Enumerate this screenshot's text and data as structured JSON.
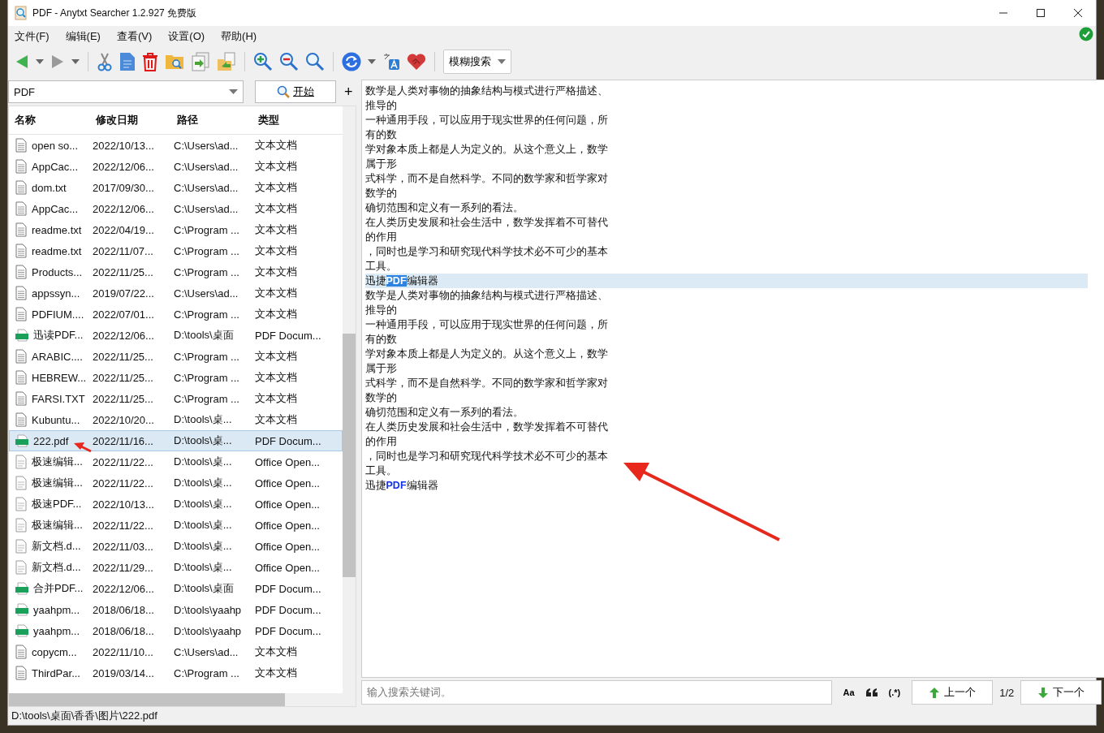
{
  "window": {
    "title": "PDF - Anytxt Searcher 1.2.927 免费版"
  },
  "menu": [
    "文件(F)",
    "编辑(E)",
    "查看(V)",
    "设置(O)",
    "帮助(H)"
  ],
  "toolbar": {
    "search_mode": "模糊搜索"
  },
  "search": {
    "value": "PDF",
    "start_button": "开始",
    "add_button": "+"
  },
  "table": {
    "columns": [
      "名称",
      "修改日期",
      "路径",
      "类型"
    ],
    "rows": [
      {
        "kind": "txt",
        "selected": false,
        "cells": [
          "open so...",
          "2022/10/13...",
          "C:\\Users\\ad...",
          "文本文档"
        ]
      },
      {
        "kind": "txt",
        "selected": false,
        "cells": [
          "AppCac...",
          "2022/12/06...",
          "C:\\Users\\ad...",
          "文本文档"
        ]
      },
      {
        "kind": "txt",
        "selected": false,
        "cells": [
          "dom.txt",
          "2017/09/30...",
          "C:\\Users\\ad...",
          "文本文档"
        ]
      },
      {
        "kind": "txt",
        "selected": false,
        "cells": [
          "AppCac...",
          "2022/12/06...",
          "C:\\Users\\ad...",
          "文本文档"
        ]
      },
      {
        "kind": "txt",
        "selected": false,
        "cells": [
          "readme.txt",
          "2022/04/19...",
          "C:\\Program ...",
          "文本文档"
        ]
      },
      {
        "kind": "txt",
        "selected": false,
        "cells": [
          "readme.txt",
          "2022/11/07...",
          "C:\\Program ...",
          "文本文档"
        ]
      },
      {
        "kind": "txt",
        "selected": false,
        "cells": [
          "Products...",
          "2022/11/25...",
          "C:\\Program ...",
          "文本文档"
        ]
      },
      {
        "kind": "txt",
        "selected": false,
        "cells": [
          "appssyn...",
          "2019/07/22...",
          "C:\\Users\\ad...",
          "文本文档"
        ]
      },
      {
        "kind": "txt",
        "selected": false,
        "cells": [
          "PDFIUM....",
          "2022/07/01...",
          "C:\\Program ...",
          "文本文档"
        ]
      },
      {
        "kind": "pdf",
        "selected": false,
        "cells": [
          "迅读PDF...",
          "2022/12/06...",
          "D:\\tools\\桌面",
          "PDF Docum..."
        ]
      },
      {
        "kind": "txt",
        "selected": false,
        "cells": [
          "ARABIC....",
          "2022/11/25...",
          "C:\\Program ...",
          "文本文档"
        ]
      },
      {
        "kind": "txt",
        "selected": false,
        "cells": [
          "HEBREW...",
          "2022/11/25...",
          "C:\\Program ...",
          "文本文档"
        ]
      },
      {
        "kind": "txt",
        "selected": false,
        "cells": [
          "FARSI.TXT",
          "2022/11/25...",
          "C:\\Program ...",
          "文本文档"
        ]
      },
      {
        "kind": "txt",
        "selected": false,
        "cells": [
          "Kubuntu...",
          "2022/10/20...",
          "D:\\tools\\桌...",
          "文本文档"
        ]
      },
      {
        "kind": "pdf",
        "selected": true,
        "cells": [
          "222.pdf",
          "2022/11/16...",
          "D:\\tools\\桌...",
          "PDF Docum..."
        ]
      },
      {
        "kind": "doc",
        "selected": false,
        "cells": [
          "极速编辑...",
          "2022/11/22...",
          "D:\\tools\\桌...",
          "Office Open..."
        ]
      },
      {
        "kind": "doc",
        "selected": false,
        "cells": [
          "极速编辑...",
          "2022/11/22...",
          "D:\\tools\\桌...",
          "Office Open..."
        ]
      },
      {
        "kind": "doc",
        "selected": false,
        "cells": [
          "极速PDF...",
          "2022/10/13...",
          "D:\\tools\\桌...",
          "Office Open..."
        ]
      },
      {
        "kind": "doc",
        "selected": false,
        "cells": [
          "极速编辑...",
          "2022/11/22...",
          "D:\\tools\\桌...",
          "Office Open..."
        ]
      },
      {
        "kind": "doc",
        "selected": false,
        "cells": [
          "新文档.d...",
          "2022/11/03...",
          "D:\\tools\\桌...",
          "Office Open..."
        ]
      },
      {
        "kind": "doc",
        "selected": false,
        "cells": [
          "新文档.d...",
          "2022/11/29...",
          "D:\\tools\\桌...",
          "Office Open..."
        ]
      },
      {
        "kind": "pdf",
        "selected": false,
        "cells": [
          "合并PDF...",
          "2022/12/06...",
          "D:\\tools\\桌面",
          "PDF Docum..."
        ]
      },
      {
        "kind": "pdf",
        "selected": false,
        "cells": [
          "yaahpm...",
          "2018/06/18...",
          "D:\\tools\\yaahp",
          "PDF Docum..."
        ]
      },
      {
        "kind": "pdf",
        "selected": false,
        "cells": [
          "yaahpm...",
          "2018/06/18...",
          "D:\\tools\\yaahp",
          "PDF Docum..."
        ]
      },
      {
        "kind": "txt",
        "selected": false,
        "cells": [
          "copycm...",
          "2022/11/10...",
          "C:\\Users\\ad...",
          "文本文档"
        ]
      },
      {
        "kind": "txt",
        "selected": false,
        "cells": [
          "ThirdPar...",
          "2019/03/14...",
          "C:\\Program ...",
          "文本文档"
        ]
      }
    ]
  },
  "preview": {
    "lines": [
      {
        "current": false,
        "parts": [
          {
            "text": "数学是人类对事物的抽象结构与模式进行严格描述、",
            "match": false
          }
        ]
      },
      {
        "current": false,
        "parts": [
          {
            "text": "推导的",
            "match": false
          }
        ]
      },
      {
        "current": false,
        "parts": [
          {
            "text": "一种通用手段，可以应用于现实世界的任何问题，所",
            "match": false
          }
        ]
      },
      {
        "current": false,
        "parts": [
          {
            "text": "有的数",
            "match": false
          }
        ]
      },
      {
        "current": false,
        "parts": [
          {
            "text": "学对象本质上都是人为定义的。从这个意义上，数学",
            "match": false
          }
        ]
      },
      {
        "current": false,
        "parts": [
          {
            "text": "属于形",
            "match": false
          }
        ]
      },
      {
        "current": false,
        "parts": [
          {
            "text": "式科学，而不是自然科学。不同的数学家和哲学家对",
            "match": false
          }
        ]
      },
      {
        "current": false,
        "parts": [
          {
            "text": "数学的",
            "match": false
          }
        ]
      },
      {
        "current": false,
        "parts": [
          {
            "text": "确切范围和定义有一系列的看法。",
            "match": false
          }
        ]
      },
      {
        "current": false,
        "parts": [
          {
            "text": "在人类历史发展和社会生活中，数学发挥着不可替代",
            "match": false
          }
        ]
      },
      {
        "current": false,
        "parts": [
          {
            "text": "的作用",
            "match": false
          }
        ]
      },
      {
        "current": false,
        "parts": [
          {
            "text": "，同时也是学习和研究现代科学技术必不可少的基本",
            "match": false
          }
        ]
      },
      {
        "current": false,
        "parts": [
          {
            "text": "工具。",
            "match": false
          }
        ]
      },
      {
        "current": true,
        "parts": [
          {
            "text": "迅捷",
            "match": false
          },
          {
            "text": "PDF",
            "match": true
          },
          {
            "text": "编辑器",
            "match": false
          }
        ]
      },
      {
        "current": false,
        "parts": [
          {
            "text": "数学是人类对事物的抽象结构与模式进行严格描述、",
            "match": false
          }
        ]
      },
      {
        "current": false,
        "parts": [
          {
            "text": "推导的",
            "match": false
          }
        ]
      },
      {
        "current": false,
        "parts": [
          {
            "text": "一种通用手段，可以应用于现实世界的任何问题，所",
            "match": false
          }
        ]
      },
      {
        "current": false,
        "parts": [
          {
            "text": "有的数",
            "match": false
          }
        ]
      },
      {
        "current": false,
        "parts": [
          {
            "text": "学对象本质上都是人为定义的。从这个意义上，数学",
            "match": false
          }
        ]
      },
      {
        "current": false,
        "parts": [
          {
            "text": "属于形",
            "match": false
          }
        ]
      },
      {
        "current": false,
        "parts": [
          {
            "text": "式科学，而不是自然科学。不同的数学家和哲学家对",
            "match": false
          }
        ]
      },
      {
        "current": false,
        "parts": [
          {
            "text": "数学的",
            "match": false
          }
        ]
      },
      {
        "current": false,
        "parts": [
          {
            "text": "确切范围和定义有一系列的看法。",
            "match": false
          }
        ]
      },
      {
        "current": false,
        "parts": [
          {
            "text": "在人类历史发展和社会生活中，数学发挥着不可替代",
            "match": false
          }
        ]
      },
      {
        "current": false,
        "parts": [
          {
            "text": "的作用",
            "match": false
          }
        ]
      },
      {
        "current": false,
        "parts": [
          {
            "text": "，同时也是学习和研究现代科学技术必不可少的基本",
            "match": false
          }
        ]
      },
      {
        "current": false,
        "parts": [
          {
            "text": "工具。",
            "match": false
          }
        ]
      },
      {
        "current": false,
        "parts": [
          {
            "text": "迅捷",
            "match": false
          },
          {
            "text": "PDF",
            "match": true
          },
          {
            "text": "编辑器",
            "match": false
          }
        ]
      }
    ]
  },
  "find_bar": {
    "placeholder": "输入搜索关键词。",
    "case_button": "Aa",
    "regex_button": "(.*)",
    "prev_button": "上一个",
    "counter": "1/2",
    "next_button": "下一个"
  },
  "status_bar": "D:\\tools\\桌面\\香香\\图片\\222.pdf"
}
